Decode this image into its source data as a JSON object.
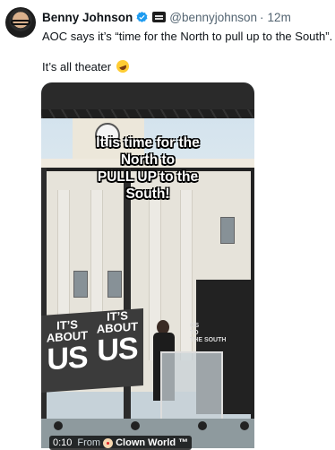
{
  "author": {
    "name": "Benny Johnson",
    "handle": "@bennyjohnson",
    "separator": "·",
    "time": "12m"
  },
  "tweet": {
    "line1": "AOC says it’s “time for the North to pull up to the South”.",
    "line2": "It’s all theater"
  },
  "video": {
    "caption_lines": [
      "It is time for the",
      "North to",
      "PULL UP to the",
      "South!"
    ],
    "sign_small": "IT’S",
    "sign_small2": "ABOUT",
    "sign_big": "US",
    "banner_lines": [
      "OS",
      "TO",
      "THE SOUTH"
    ],
    "timecode": "0:10",
    "from_label": "From",
    "source": "Clown World ™"
  },
  "colors": {
    "verified": "#1d9bf0",
    "text": "#0f1419",
    "muted": "#536471"
  },
  "icons": {
    "verified": "verified-badge-icon",
    "org": "affiliate-badge-icon",
    "emoji": "laughing-emoji-icon",
    "source": "clown-emoji-icon"
  }
}
